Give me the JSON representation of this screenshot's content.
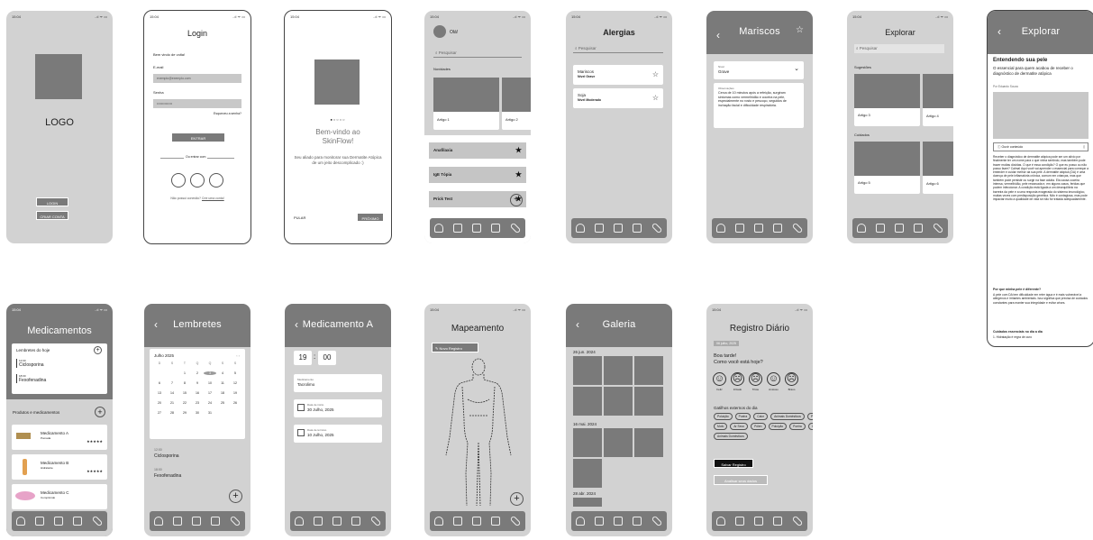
{
  "status": {
    "time": "15:04",
    "icons": "..ıl ᯤ ▭"
  },
  "splash": {
    "logo": "LOGO",
    "login": "LOGIN",
    "create": "CRIAR CONTA"
  },
  "login": {
    "title": "Login",
    "welcome": "Bem vindo de volta!",
    "email_label": "E-mail",
    "email_value": "exemplo@exemplo.com",
    "pass_label": "Senha",
    "pass_value": "••••••••••••••",
    "forgot": "Esqueceu a senha?",
    "enter": "ENTRAR",
    "or": "Ou entrar com",
    "no_account": "Não possui conexão?",
    "create": "Crie uma conta!"
  },
  "onboard": {
    "title": "Bem-vindo ao SkinFlow!",
    "text": "Seu aliado para monitorar sua Dermatite Atópica de um jeito descomplicado :)",
    "skip": "PULAR",
    "next": "PRÓXIMO"
  },
  "home": {
    "greeting": "Olá!",
    "search": "Pesquisar",
    "news": "Novidades",
    "article1": "Artigo 1",
    "article2": "Artigo 2",
    "items": [
      "Anafilaxia",
      "IgE Tópia",
      "Prick Test"
    ]
  },
  "allergies": {
    "title": "Alergias",
    "search": "Pesquisar",
    "items": [
      {
        "name": "Mariscos",
        "level": "Nível Grave"
      },
      {
        "name": "Soja",
        "level": "Nível Moderado"
      }
    ]
  },
  "mariscos": {
    "title": "Mariscos",
    "level_label": "Nível",
    "level_value": "Grave",
    "desc_label": "Observações",
    "desc": "Cerca de 10 minutos após a refeição, surgiram sintomas como vermelhidão e coceira na pele, especialmente no rosto e pescoço, seguidos de inchação facial e dificuldade respiratória."
  },
  "explore": {
    "title": "Explorar",
    "search": "Pesquisar",
    "s1": "Sugestões",
    "a3": "Artigo 3",
    "a4": "Artigo 4",
    "s2": "Cuidados",
    "a5": "Artigo 5",
    "a6": "Artigo 6"
  },
  "article": {
    "title": "Explorar",
    "heading": "Entendendo sua pele",
    "sub": "O essencial para quem acabou de receber o diagnóstico de dermatite atópica",
    "author": "Por Eduardo Souza",
    "listen": "Ouvir conteúdo",
    "body": "Receber o diagnóstico de dermatite atópica pode ser um alívio por finalmente ter um nome para o que vinha sentindo, mas também pode trazer muitas dúvidas. O que é essa condição? O que eu posso ou não posso fazer? Calma! Aqui você vai aprender o essencial para começar a entender e cuidar melhor da sua pele. A dermatite atópica (DA) é uma doença de pele inflamatória crônica, comum em crianças, mas que também pode persistir ou surgir na fase adulta. Ela causa coceira intensa, vermelhidão, pele ressecada e, em alguns casos, feridas que podem infeccionar. A condição está ligada a um desequilíbrio na barreira da pele e a uma resposta exagerada do sistema imunológico, muitas vezes com predisposição genética. Não é contagiosa, mas pode impactar muito a qualidade de vida se não for tratada adequadamente.",
    "q": "Por que minha pele é diferente?",
    "body2": "A pele com DA tem dificuldade em reter água e é mais vulnerável a alérgenos e irritantes ambientais. Isso significa que precisa de cuidados constantes para manter sua integridade e evitar crises.",
    "care": "Cuidados essenciais no dia a dia",
    "care1": "1. Hidratação é regra de ouro"
  },
  "meds": {
    "title": "Medicamentos",
    "reminders": "Lembretes do hoje",
    "r1_time": "12:00",
    "r1": "Ciclosporina",
    "r2_time": "18:00",
    "r2": "Fexofenadina",
    "products": "Produtos e medicamentos",
    "list": [
      {
        "name": "Medicamento A",
        "type": "Pomada",
        "stars": "★★★★★"
      },
      {
        "name": "Medicamento B",
        "type": "Hidratante",
        "stars": "★★★★★"
      },
      {
        "name": "Medicamento C",
        "type": "Comprimido",
        "stars": ""
      }
    ]
  },
  "remind": {
    "title": "Lembretes",
    "month": "Julho 2025",
    "dow": [
      "D",
      "S",
      "T",
      "Q",
      "Q",
      "S",
      "S"
    ],
    "days": [
      "",
      "",
      "1",
      "2",
      "3",
      "4",
      "5",
      "6",
      "7",
      "8",
      "9",
      "10",
      "11",
      "12",
      "13",
      "14",
      "15",
      "16",
      "17",
      "18",
      "19",
      "20",
      "21",
      "22",
      "23",
      "24",
      "25",
      "26",
      "27",
      "28",
      "29",
      "30",
      "31",
      "",
      ""
    ],
    "t1": "12:00",
    "m1": "Ciclosporina",
    "t2": "18:00",
    "m2": "Fexofenadina"
  },
  "medA": {
    "title": "Medicamento A",
    "hour": "19",
    "minute": "00",
    "med_label": "Medicamento",
    "med": "Tacrolimo",
    "start_label": "Data de início",
    "start": "30 Julho, 2025",
    "end_label": "Data de término",
    "end": "10 Julho, 2025"
  },
  "map": {
    "title": "Mapeamento",
    "new": "Novo Registro"
  },
  "gallery": {
    "title": "Galeria",
    "d1": "26 jun. 2024",
    "d2": "16 mai. 2024",
    "d3": "28 abr. 2024"
  },
  "diary": {
    "title": "Registro Diário",
    "date": "06 julho, 2025",
    "greet": "Boa tarde!",
    "question": "Como você está hoje?",
    "moods": [
      "Feliz",
      "Irritado",
      "Triste",
      "Ansioso",
      "Bravo"
    ],
    "gatilhos": "Gatilhos externos do dia",
    "tags": [
      "Poluição",
      "Poeira",
      "Calor",
      "Animais Domésticos",
      "Perfume",
      "Mofo",
      "Ar Seco",
      "Pólen",
      "Poluição",
      "Poeira",
      "Calor",
      "Animais Domésticos"
    ],
    "save": "Salvar Registro",
    "analyze": "Analisar seus dados"
  }
}
